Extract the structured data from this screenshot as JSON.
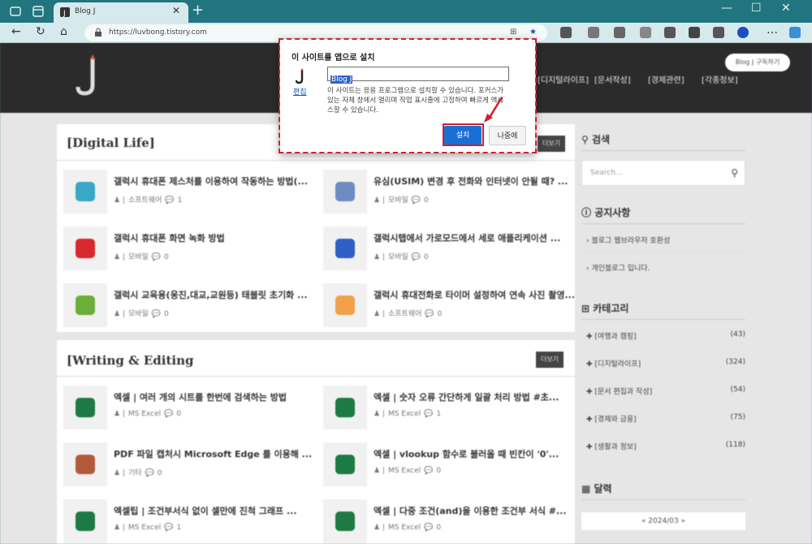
{
  "browser": {
    "tab_title": "Blog J",
    "tab_close": "✕",
    "new_tab": "+",
    "url": "https://luvbong.tistory.com",
    "window": {
      "min": "—",
      "max": "☐",
      "close": "✕"
    }
  },
  "site": {
    "menu": [
      "[디지털라이프]",
      "[문서작성]",
      "[경제관련]",
      "[각종정보]"
    ],
    "subscribe": "Blog J 구독하기"
  },
  "sections": [
    {
      "title": "[Digital Life]",
      "more": "더보기",
      "cards": [
        {
          "title": "갤럭시 휴대폰 제스처를 이용하여 작동하는 방법(...",
          "meta": [
            "소프트웨어",
            "1"
          ],
          "icon_color": "#3aa7c6"
        },
        {
          "title": "유심(USIM) 변경 후 전화와 인터넷이 안될 때? ...",
          "meta": [
            "모바일",
            "0"
          ],
          "icon_color": "#6e8cc0"
        },
        {
          "title": "갤럭시 휴대폰 화면 녹화 방법",
          "meta": [
            "모바일",
            "0"
          ],
          "icon_color": "#d9282f"
        },
        {
          "title": "갤럭시탭에서 가로모드에서 세로 애플리케이션 ...",
          "meta": [
            "모바일",
            "0"
          ],
          "icon_color": "#2f5fc4"
        },
        {
          "title": "갤럭시 교육용(웅진,대교,교원등) 태블릿 초기화 ...",
          "meta": [
            "모바일",
            "0"
          ],
          "icon_color": "#6cae3a"
        },
        {
          "title": "갤럭시 휴대전화로 타이머 설정하여 연속 사진 촬영...",
          "meta": [
            "소프트웨어",
            "0"
          ],
          "icon_color": "#f2a04a"
        }
      ]
    },
    {
      "title": "[Writing & Editing",
      "more": "더보기",
      "cards": [
        {
          "title": "엑셀 | 여러 개의 시트를 한번에 검색하는 방법",
          "meta": [
            "MS Excel",
            "0"
          ],
          "icon_color": "#1d7a45"
        },
        {
          "title": "엑셀 | 숫자 오류 간단하게 일괄 처리 방법 #초...",
          "meta": [
            "MS Excel",
            "1"
          ],
          "icon_color": "#1d7a45"
        },
        {
          "title": "PDF 파일 캡처시 Microsoft Edge 를 이용해 ...",
          "meta": [
            "기타",
            "0"
          ],
          "icon_color": "#b25a3a"
        },
        {
          "title": "엑셀 | vlookup 함수로 불러올 때 빈칸이 '0'...",
          "meta": [
            "MS Excel",
            "0"
          ],
          "icon_color": "#1d7a45"
        },
        {
          "title": "엑셀팁 | 조건부서식 없이 셀만에 진척 그래프 ...",
          "meta": [
            "MS Excel",
            "1"
          ],
          "icon_color": "#1d7a45"
        },
        {
          "title": "엑셀 | 다중 조건(and)을 이용한 조건부 서식 #...",
          "meta": [
            "MS Excel",
            "0"
          ],
          "icon_color": "#1d7a45"
        }
      ]
    }
  ],
  "sidebar": {
    "search_head": "검색",
    "search_placeholder": "Search...",
    "notice_head": "공지사항",
    "notices": [
      "블로그 웹브라우저 호환성",
      "개인블로그 입니다."
    ],
    "category_head": "카테고리",
    "categories": [
      {
        "name": "[여행과 캠핑]",
        "count": "(43)"
      },
      {
        "name": "[디지털라이프]",
        "count": "(324)"
      },
      {
        "name": "[문서 편집과 작성]",
        "count": "(54)"
      },
      {
        "name": "[경제와 금융]",
        "count": "(75)"
      },
      {
        "name": "[생활과 정보]",
        "count": "(118)"
      }
    ],
    "calendar_head": "달력",
    "calendar": "« 2024/03 »"
  },
  "dialog": {
    "title": "이 사이트를 앱으로 설치",
    "edit": "편집",
    "name_value": "Blog J",
    "description": "이 사이트는 응용 프로그램으로 설치할 수 있습니다. 포커스가 있는 자체 창에서 열리며 작업 표시줄에 고정하여 빠르게 액세스할 수 있습니다.",
    "install": "설치",
    "later": "나중에"
  },
  "colors": {
    "accent": "#1a6fd6",
    "highlight": "#d0202a",
    "tabbar": "#21757f"
  }
}
